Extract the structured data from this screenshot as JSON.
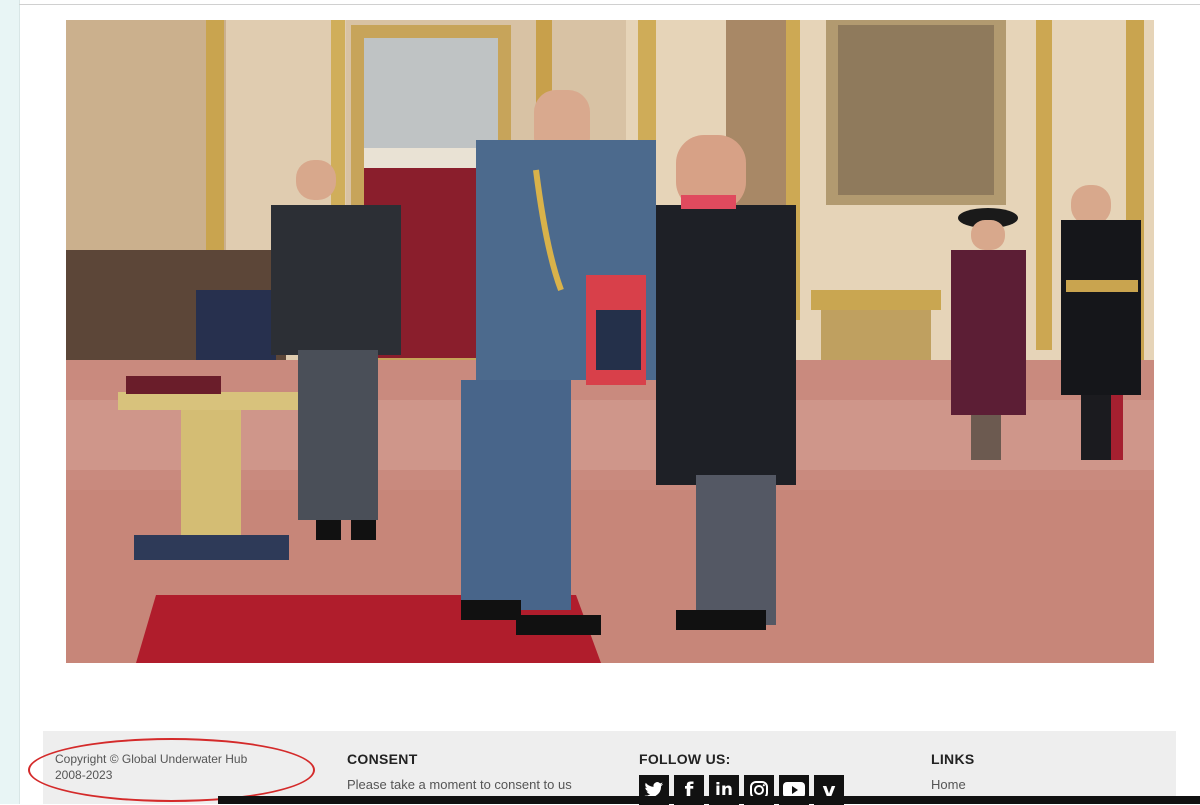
{
  "footer": {
    "copyright_line1": "Copyright © Global Underwater Hub",
    "copyright_line2": "2008-2023",
    "consent": {
      "title": "CONSENT",
      "text": "Please take a moment to consent to us"
    },
    "follow": {
      "title": "FOLLOW US:",
      "icons": [
        "twitter-icon",
        "facebook-icon",
        "linkedin-icon",
        "instagram-icon",
        "youtube-icon",
        "vimeo-icon"
      ],
      "glyphs": [
        "🐦",
        "f",
        "in",
        "◎",
        "▶",
        "v"
      ]
    },
    "links": {
      "title": "LINKS",
      "home": "Home"
    }
  },
  "colors": {
    "footer_bg": "#eeeeee",
    "annotation_red": "#d42a2a",
    "carpet": "#c98a7e",
    "red_carpet": "#b01d2c",
    "uniform_blue": "#4c6a8d"
  }
}
